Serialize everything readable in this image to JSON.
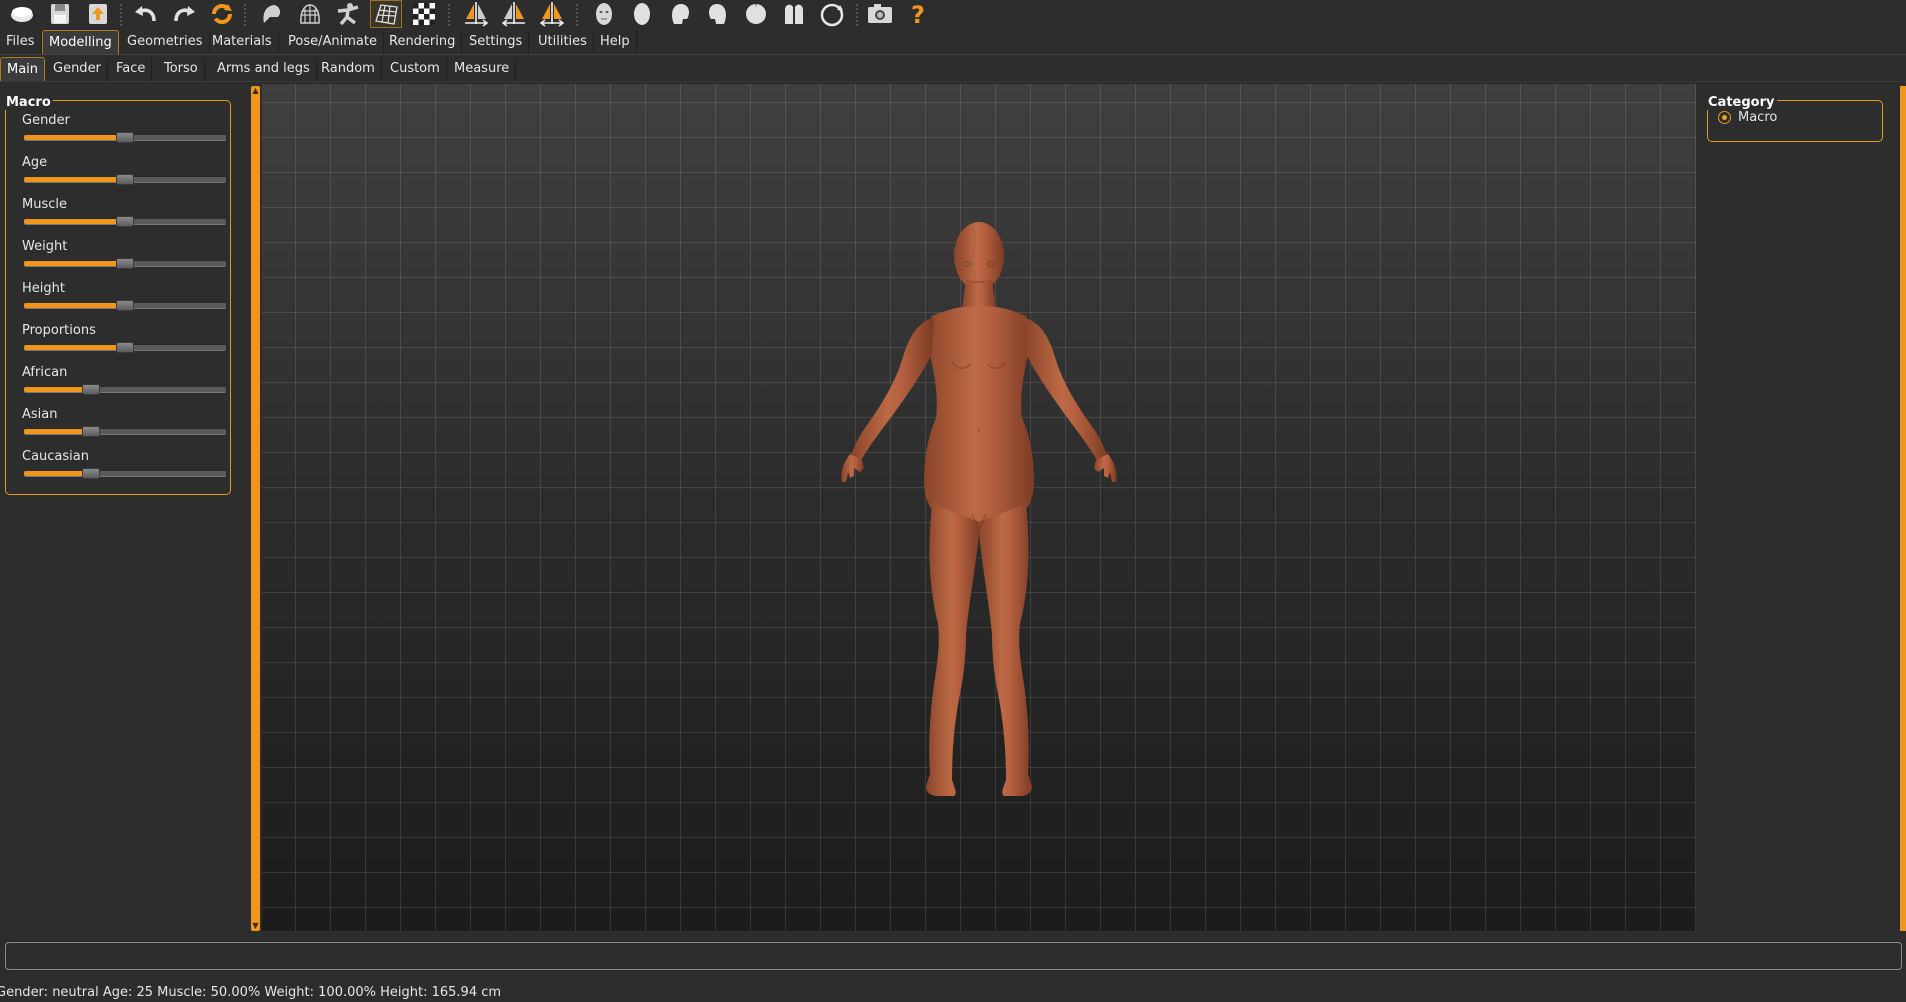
{
  "toolbar": {
    "buttons": [
      "new-icon",
      "save-icon",
      "export-icon",
      "undo-icon",
      "redo-icon",
      "reset-icon",
      "smooth-icon",
      "wireframe-icon",
      "pose-icon",
      "grid-icon",
      "checker-background-icon",
      "symmetry-right-icon",
      "symmetry-left-icon",
      "symmetry-icon",
      "front-view-icon",
      "back-view-icon",
      "left-view-icon",
      "right-view-icon",
      "top-view-icon",
      "bottom-view-icon",
      "reset-camera-icon",
      "screenshot-icon",
      "help-icon"
    ]
  },
  "tabs": [
    "Files",
    "Modelling",
    "Geometries",
    "Materials",
    "Pose/Animate",
    "Rendering",
    "Settings",
    "Utilities",
    "Help"
  ],
  "subtabs": [
    "Main",
    "Gender",
    "Face",
    "Torso",
    "Arms and legs",
    "Random",
    "Custom",
    "Measure"
  ],
  "macro": {
    "title": "Macro",
    "sliders": [
      {
        "label": "Gender",
        "value": 0.5
      },
      {
        "label": "Age",
        "value": 0.5
      },
      {
        "label": "Muscle",
        "value": 0.5
      },
      {
        "label": "Weight",
        "value": 0.5
      },
      {
        "label": "Height",
        "value": 0.5
      },
      {
        "label": "Proportions",
        "value": 0.5
      },
      {
        "label": "African",
        "value": 0.333
      },
      {
        "label": "Asian",
        "value": 0.333
      },
      {
        "label": "Caucasian",
        "value": 0.333
      }
    ]
  },
  "category": {
    "title": "Category",
    "option": "Macro"
  },
  "status": "Gender: neutral Age: 25 Muscle: 50.00% Weight: 100.00% Height: 165.94 cm",
  "colors": {
    "accent": "#f0961c",
    "skin": "#b3603c"
  }
}
